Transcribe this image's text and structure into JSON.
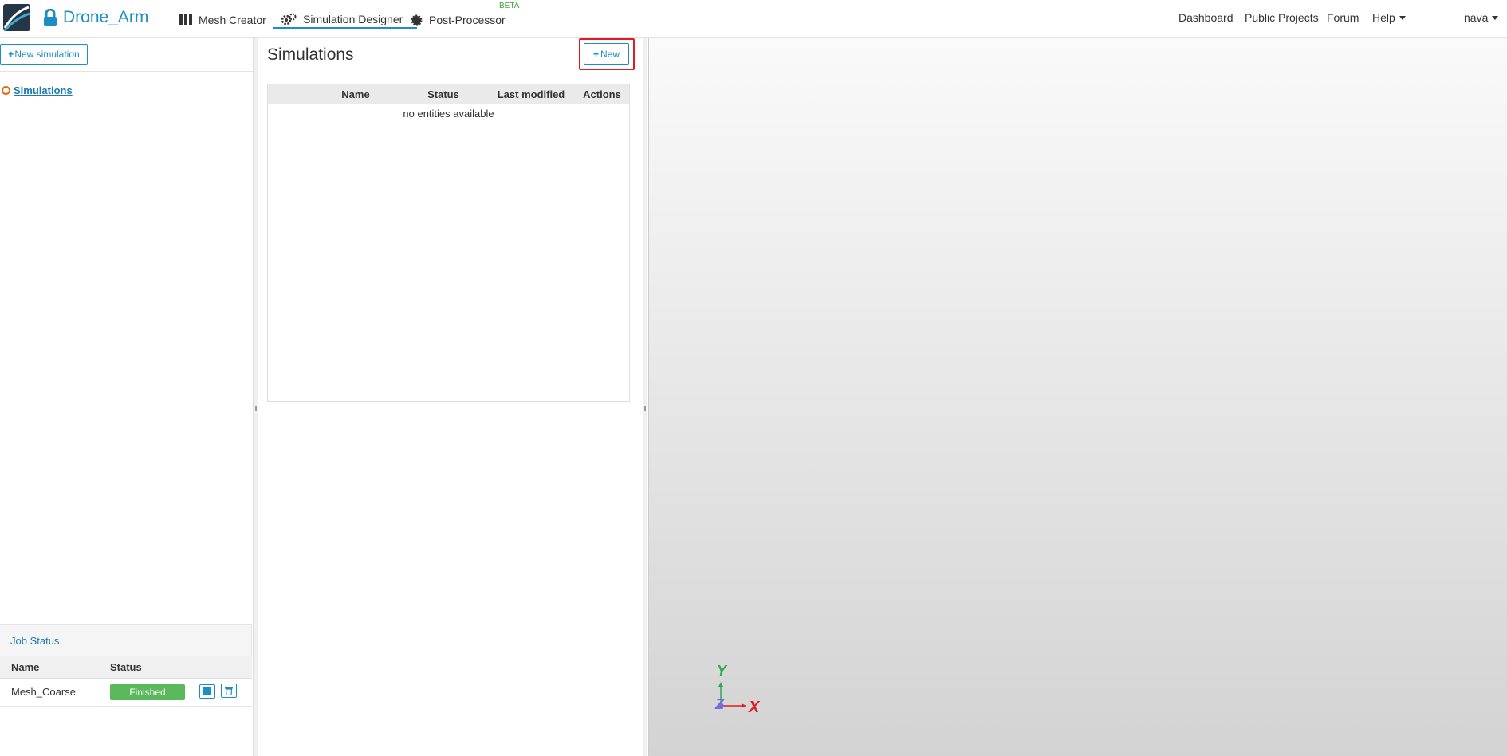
{
  "navbar": {
    "project_name": "Drone_Arm",
    "tabs": [
      {
        "label": "Mesh Creator",
        "icon": "grid-icon"
      },
      {
        "label": "Simulation Designer",
        "icon": "gears-icon"
      },
      {
        "label": "Post-Processor",
        "icon": "cog-icon"
      }
    ],
    "beta_badge": "BETA",
    "right_links": [
      "Dashboard",
      "Public Projects",
      "Forum",
      "Help"
    ],
    "user": "nava"
  },
  "left_panel": {
    "new_simulation_button": "New simulation",
    "tree": {
      "root_label": "Simulations"
    }
  },
  "job_status": {
    "title": "Job Status",
    "columns": [
      "Name",
      "Status"
    ],
    "rows": [
      {
        "name": "Mesh_Coarse",
        "status": "Finished"
      }
    ]
  },
  "middle_panel": {
    "title": "Simulations",
    "new_button": "New",
    "table": {
      "columns": [
        "Name",
        "Status",
        "Last modified",
        "Actions"
      ],
      "empty_text": "no entities available"
    }
  },
  "viewport": {
    "axes": {
      "x": "X",
      "y": "Y",
      "z": "Z"
    },
    "colors": {
      "x": "#e01b24",
      "y": "#2fa84f",
      "z": "#6f6fe0"
    }
  },
  "colors": {
    "accent": "#1b8fc4",
    "highlight": "#e01b24",
    "finished": "#5cb85c"
  }
}
